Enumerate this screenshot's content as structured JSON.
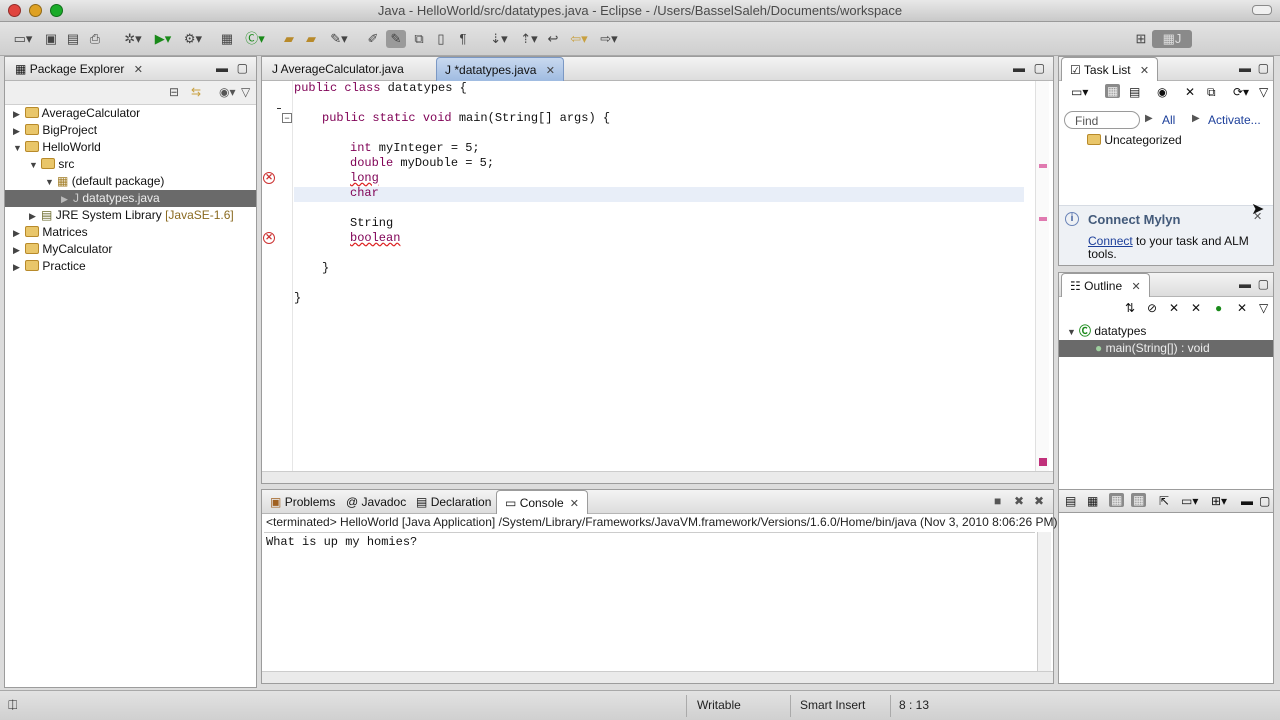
{
  "window": {
    "title": "Java - HelloWorld/src/datatypes.java - Eclipse - /Users/BasselSaleh/Documents/workspace"
  },
  "package_explorer": {
    "tab_label": "Package Explorer",
    "items": [
      {
        "label": "AverageCalculator",
        "icon": "project-folder-icon"
      },
      {
        "label": "BigProject",
        "icon": "project-folder-icon"
      },
      {
        "label": "HelloWorld",
        "icon": "project-folder-icon"
      },
      {
        "label": "src",
        "icon": "source-folder-icon"
      },
      {
        "label": "(default package)",
        "icon": "package-icon"
      },
      {
        "label": "datatypes.java",
        "icon": "java-file-icon"
      },
      {
        "label": "JRE System Library",
        "suffix": "[JavaSE-1.6]",
        "icon": "library-icon"
      },
      {
        "label": "Matrices",
        "icon": "project-folder-icon"
      },
      {
        "label": "MyCalculator",
        "icon": "project-folder-icon"
      },
      {
        "label": "Practice",
        "icon": "project-folder-icon"
      }
    ]
  },
  "editor": {
    "tabs": [
      {
        "label": "AverageCalculator.java"
      },
      {
        "label": "*datatypes.java"
      }
    ],
    "lines": {
      "l1_kw": "public class",
      "l1_rest": " datatypes {",
      "l2_kw": "public static void",
      "l2_rest": " main(String[] args) {",
      "l3_kw": "int",
      "l3_rest": " myInteger = 5;",
      "l4_kw": "double",
      "l4_rest": " myDouble = 5;",
      "l5": "long",
      "l6": "char",
      "l7": "String",
      "l8": "boolean",
      "l9": "}",
      "l10": "}"
    }
  },
  "task_list": {
    "tab_label": "Task List",
    "find_placeholder": "Find",
    "filter_all": "All",
    "activate": "Activate...",
    "category": "Uncategorized",
    "mylyn_title": "Connect Mylyn",
    "mylyn_link": "Connect",
    "mylyn_text_1": "to your task and ALM",
    "mylyn_text_2": "tools."
  },
  "outline": {
    "tab_label": "Outline",
    "class_name": "datatypes",
    "method": "main(String[]) : void"
  },
  "console": {
    "tabs": [
      {
        "label": "Problems"
      },
      {
        "label": "Javadoc"
      },
      {
        "label": "Declaration"
      },
      {
        "label": "Console"
      }
    ],
    "terminated_line": "<terminated> HelloWorld [Java Application] /System/Library/Frameworks/JavaVM.framework/Versions/1.6.0/Home/bin/java (Nov 3, 2010 8:06:26 PM)",
    "output": "What is up my homies?"
  },
  "statusbar": {
    "writable": "Writable",
    "insert_mode": "Smart Insert",
    "position": "8 : 13"
  },
  "colors": {
    "keyword": "#7f0055",
    "error": "#cc3333",
    "selection": "#6a6a6a"
  }
}
